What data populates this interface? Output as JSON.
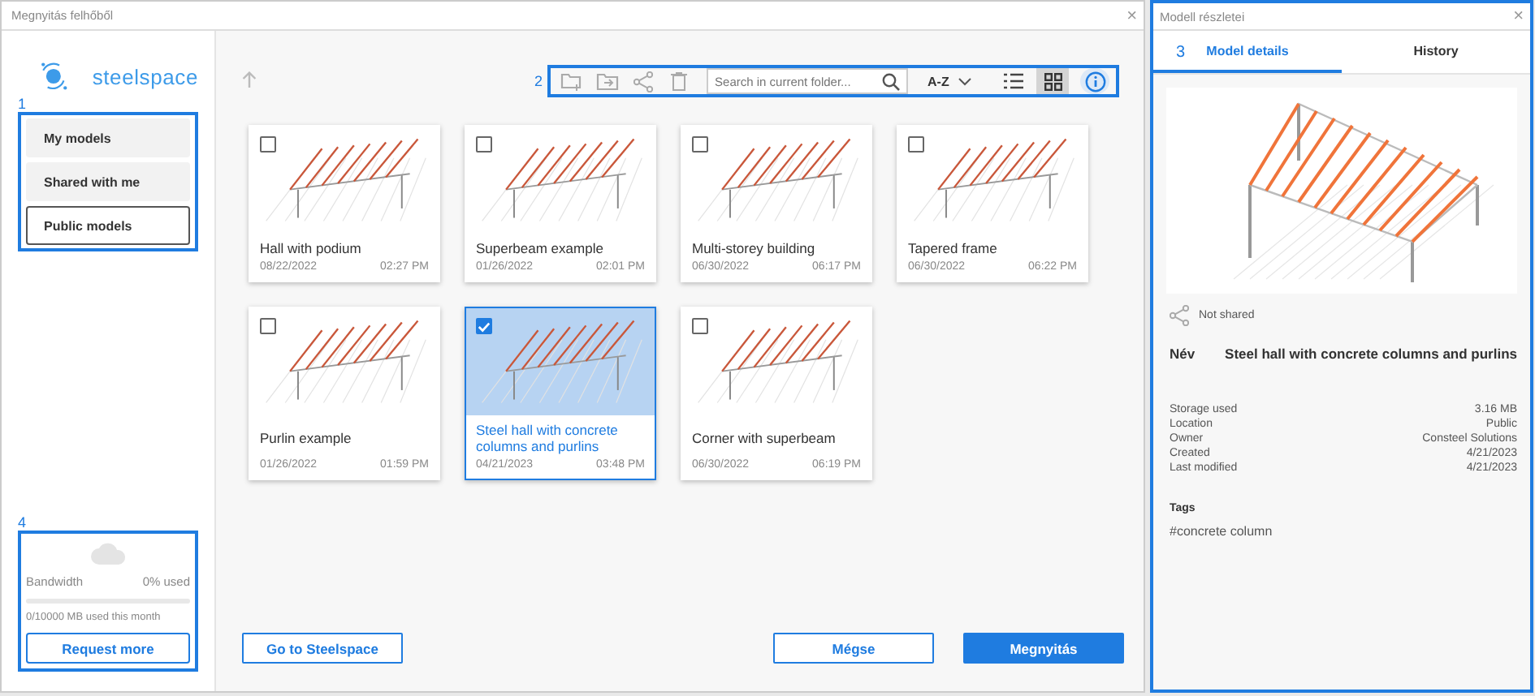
{
  "dialog": {
    "title": "Megnyitás felhőből",
    "close": "×"
  },
  "sidebar": {
    "logo": "steelspace",
    "callout": "1",
    "items": [
      {
        "label": "My models",
        "selected": false
      },
      {
        "label": "Shared with me",
        "selected": false
      },
      {
        "label": "Public models",
        "selected": true
      }
    ],
    "bandwidth": {
      "callout": "4",
      "label": "Bandwidth",
      "usage": "0% used",
      "level": 0,
      "detail": "0/10000 MB used this month",
      "button": "Request more"
    }
  },
  "toolbar": {
    "callout": "2",
    "search": {
      "placeholder": "Search in current folder..."
    },
    "sort": "A-Z",
    "views": [
      {
        "kind": "list",
        "selected": false
      },
      {
        "kind": "grid",
        "selected": true
      }
    ]
  },
  "models": [
    {
      "name": "Hall with podium",
      "date": "08/22/2022",
      "time": "02:27 PM",
      "checked": false,
      "selected": false
    },
    {
      "name": "Superbeam example",
      "date": "01/26/2022",
      "time": "02:01 PM",
      "checked": false,
      "selected": false
    },
    {
      "name": "Multi-storey building",
      "date": "06/30/2022",
      "time": "06:17 PM",
      "checked": false,
      "selected": false
    },
    {
      "name": "Tapered frame",
      "date": "06/30/2022",
      "time": "06:22 PM",
      "checked": false,
      "selected": false
    },
    {
      "name": "Purlin example",
      "date": "01/26/2022",
      "time": "01:59 PM",
      "checked": false,
      "selected": false
    },
    {
      "name": "Steel hall with concrete columns and purlins",
      "date": "04/21/2023",
      "time": "03:48 PM",
      "checked": true,
      "selected": true
    },
    {
      "name": "Corner with superbeam",
      "date": "06/30/2022",
      "time": "06:19 PM",
      "checked": false,
      "selected": false
    }
  ],
  "buttons": [
    {
      "label": "Go to Steelspace",
      "kind": "secondary"
    },
    {
      "label": "Mégse",
      "kind": "secondary"
    },
    {
      "label": "Megnyitás",
      "kind": "primary"
    }
  ],
  "details": {
    "title": "Modell részletei",
    "close": "×",
    "callout": "3",
    "tabs": [
      {
        "label": "Model details",
        "selected": true
      },
      {
        "label": "History",
        "selected": false
      }
    ],
    "sharing": "Not shared",
    "name_label": "Név",
    "name": "Steel hall with concrete columns and purlins",
    "properties": [
      {
        "label": "Storage used",
        "value": "3.16 MB"
      },
      {
        "label": "Location",
        "value": "Public"
      },
      {
        "label": "Owner",
        "value": "Consteel Solutions"
      },
      {
        "label": "Created",
        "value": "4/21/2023"
      },
      {
        "label": "Last modified",
        "value": "4/21/2023"
      }
    ],
    "tags_label": "Tags",
    "tags": [
      "#concrete column"
    ]
  }
}
